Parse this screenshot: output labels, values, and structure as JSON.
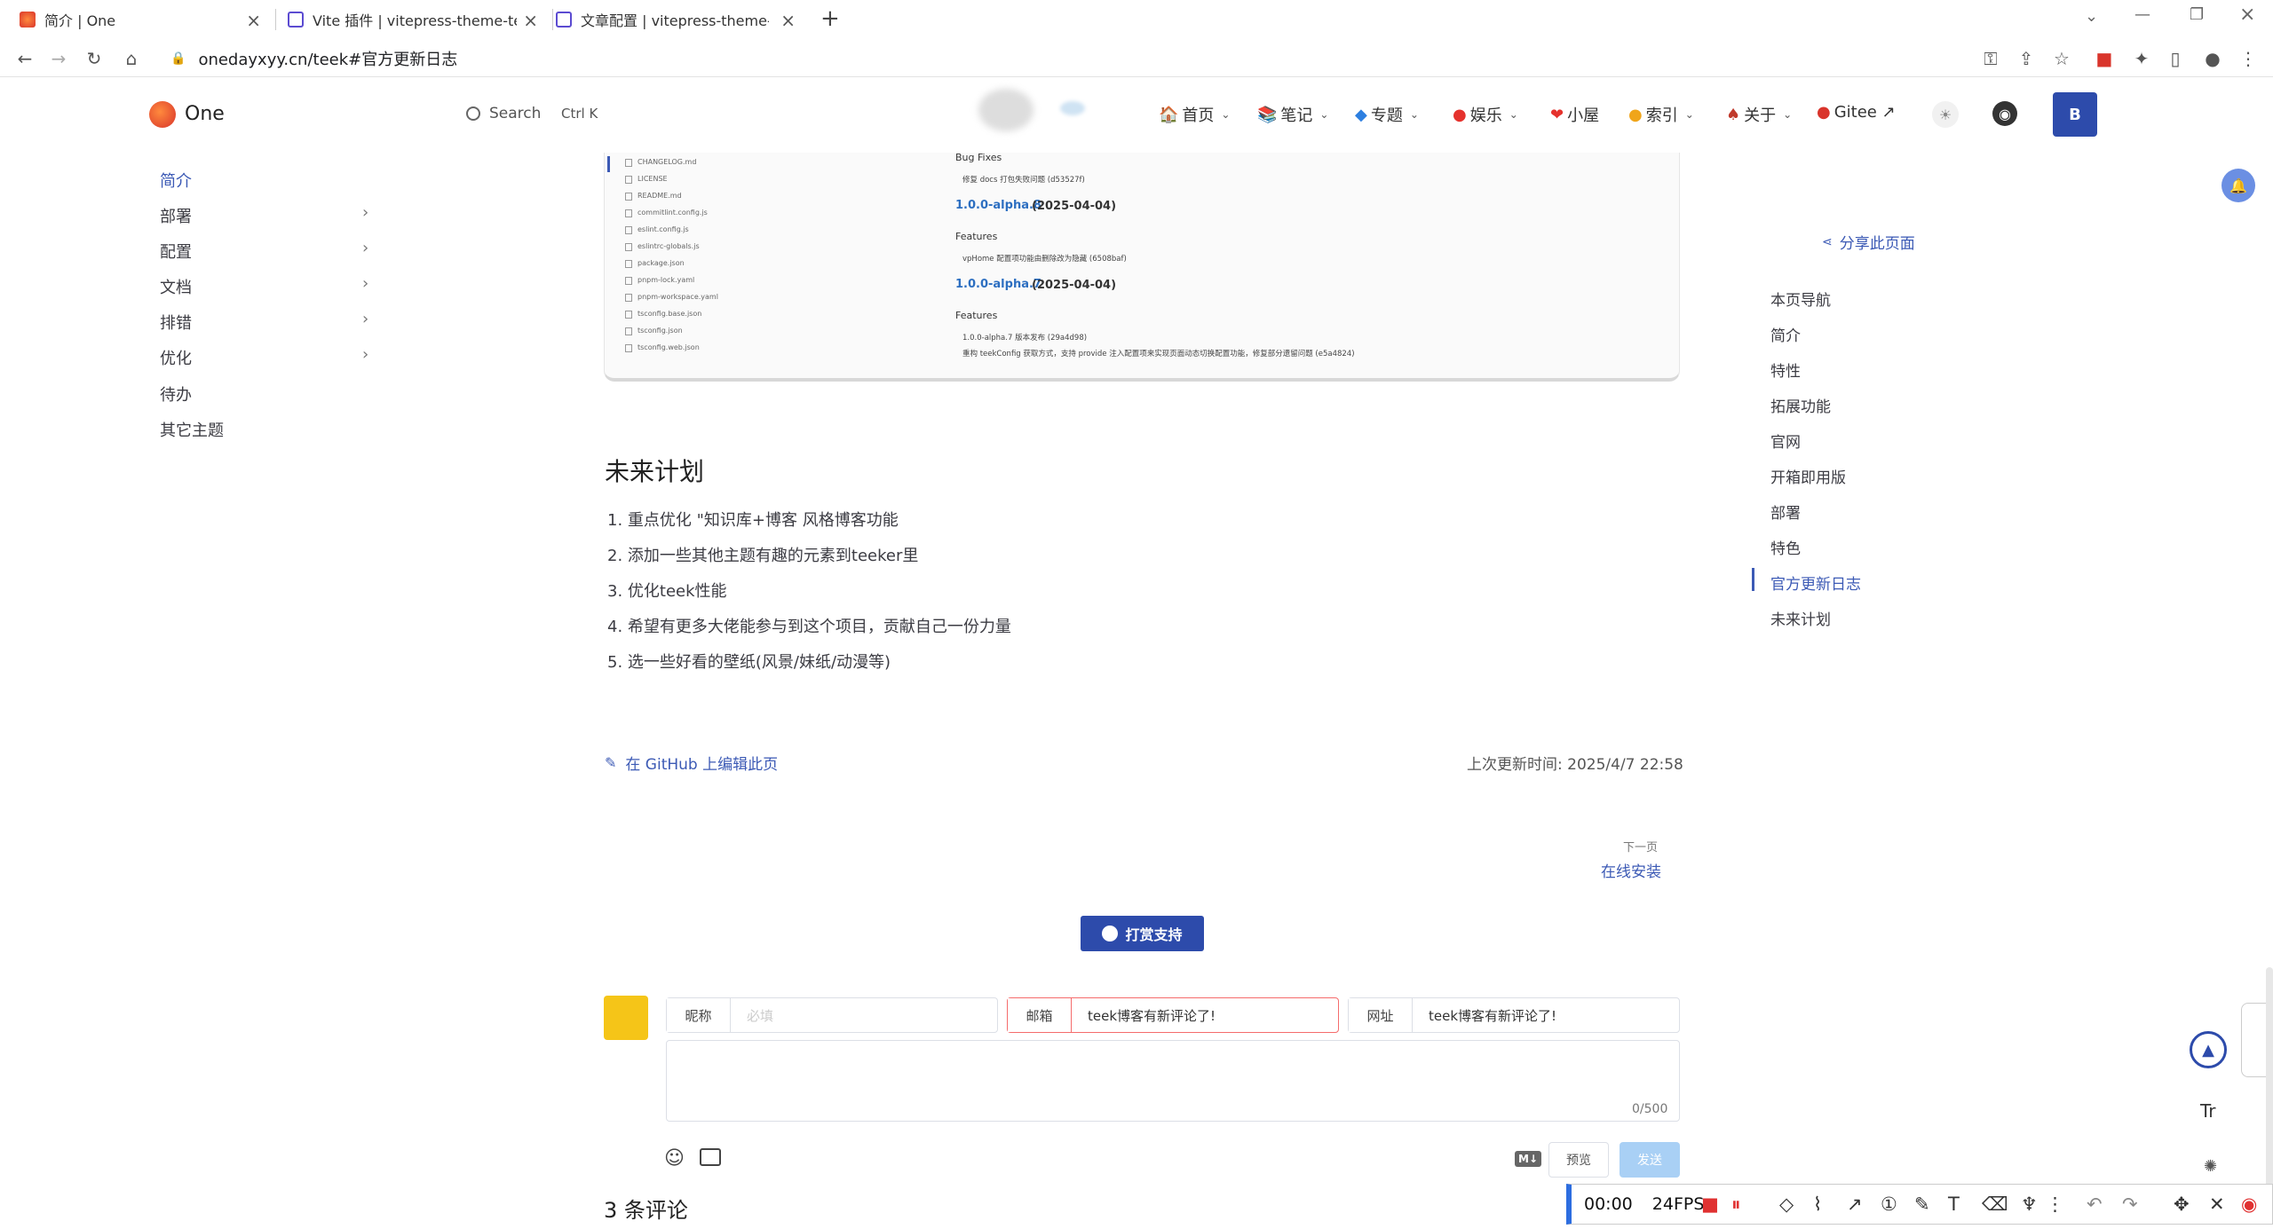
{
  "browser": {
    "tabs": [
      {
        "title": "简介 | One"
      },
      {
        "title": "Vite 插件 | vitepress-theme-tee"
      },
      {
        "title": "文章配置 | vitepress-theme-tee"
      }
    ],
    "new_tab": "+",
    "url": "onedayxyy.cn/teek#官方更新日志"
  },
  "site": {
    "brand": "One",
    "search_label": "Search",
    "search_kbd": "Ctrl K",
    "nav": [
      {
        "label": "首页",
        "icon": "house-icon"
      },
      {
        "label": "笔记",
        "icon": "book-icon"
      },
      {
        "label": "专题",
        "icon": "gem-icon"
      },
      {
        "label": "娱乐",
        "icon": "game-icon"
      },
      {
        "label": "小屋",
        "icon": "heart-icon"
      },
      {
        "label": "索引",
        "icon": "lemon-icon"
      },
      {
        "label": "关于",
        "icon": "person-icon"
      },
      {
        "label": "Gitee ↗",
        "icon": "gitee-icon"
      }
    ],
    "user_button": "B"
  },
  "sidebar": {
    "items": [
      {
        "label": "简介",
        "active": true
      },
      {
        "label": "部署",
        "expandable": true
      },
      {
        "label": "配置",
        "expandable": true
      },
      {
        "label": "文档",
        "expandable": true
      },
      {
        "label": "排错",
        "expandable": true
      },
      {
        "label": "优化",
        "expandable": true
      },
      {
        "label": "待办"
      },
      {
        "label": "其它主题"
      }
    ]
  },
  "doc_image": {
    "files": [
      "CHANGELOG.md",
      "LICENSE",
      "README.md",
      "commitlint.config.js",
      "eslint.config.js",
      "eslintrc-globals.js",
      "package.json",
      "pnpm-lock.yaml",
      "pnpm-workspace.yaml",
      "tsconfig.base.json",
      "tsconfig.json",
      "tsconfig.web.json"
    ],
    "bug_fixes": "Bug Fixes",
    "fix1": "修复 docs 打包失败问题 (d53527f)",
    "v8": "1.0.0-alpha.8",
    "v8_date": "(2025-04-04)",
    "features1": "Features",
    "feat1": "vpHome 配置项功能由删除改为隐藏 (6508baf)",
    "v7": "1.0.0-alpha.7",
    "v7_date": "(2025-04-04)",
    "features2": "Features",
    "feat2": "1.0.0-alpha.7 版本发布 (29a4d98)",
    "feat3": "重构 teekConfig 获取方式，支持 provide 注入配置项来实现页面动态切换配置功能，修复部分遗留问题 (e5a4824)"
  },
  "content": {
    "heading": "未来计划",
    "list": [
      "1. 重点优化 \"知识库+博客 风格博客功能",
      "2. 添加一些其他主题有趣的元素到teeker里",
      "3. 优化teek性能",
      "4. 希望有更多大佬能参与到这个项目，贡献自己一份力量",
      "5. 选一些好看的壁纸(风景/妹纸/动漫等)"
    ],
    "edit_link": "在 GitHub 上编辑此页",
    "last_updated": "上次更新时间: 2025/4/7 22:58",
    "next_label": "下一页",
    "next_title": "在线安装",
    "reward": "打赏支持"
  },
  "comment": {
    "nick_label": "昵称",
    "nick_placeholder": "必填",
    "mail_label": "邮箱",
    "mail_value": "teek博客有新评论了!",
    "link_label": "网址",
    "link_value": "teek博客有新评论了!",
    "counter": "0/500",
    "md_badge": "M↓",
    "preview": "预览",
    "send": "发送",
    "count_title": "3 条评论"
  },
  "toc": {
    "share": "分享此页面",
    "items": [
      {
        "label": "本页导航"
      },
      {
        "label": "简介"
      },
      {
        "label": "特性"
      },
      {
        "label": "拓展功能"
      },
      {
        "label": "官网"
      },
      {
        "label": "开箱即用版"
      },
      {
        "label": "部署"
      },
      {
        "label": "特色"
      },
      {
        "label": "官方更新日志",
        "active": true
      },
      {
        "label": "未来计划"
      }
    ]
  },
  "recorder": {
    "time": "00:00",
    "fps": "24FPS"
  },
  "colors": {
    "accent": "#3c5ab5",
    "button_dark": "#2d4bab",
    "error_border": "#f56c6c",
    "avatar": "#f5c518",
    "send_disabled": "#a9d0f5"
  }
}
